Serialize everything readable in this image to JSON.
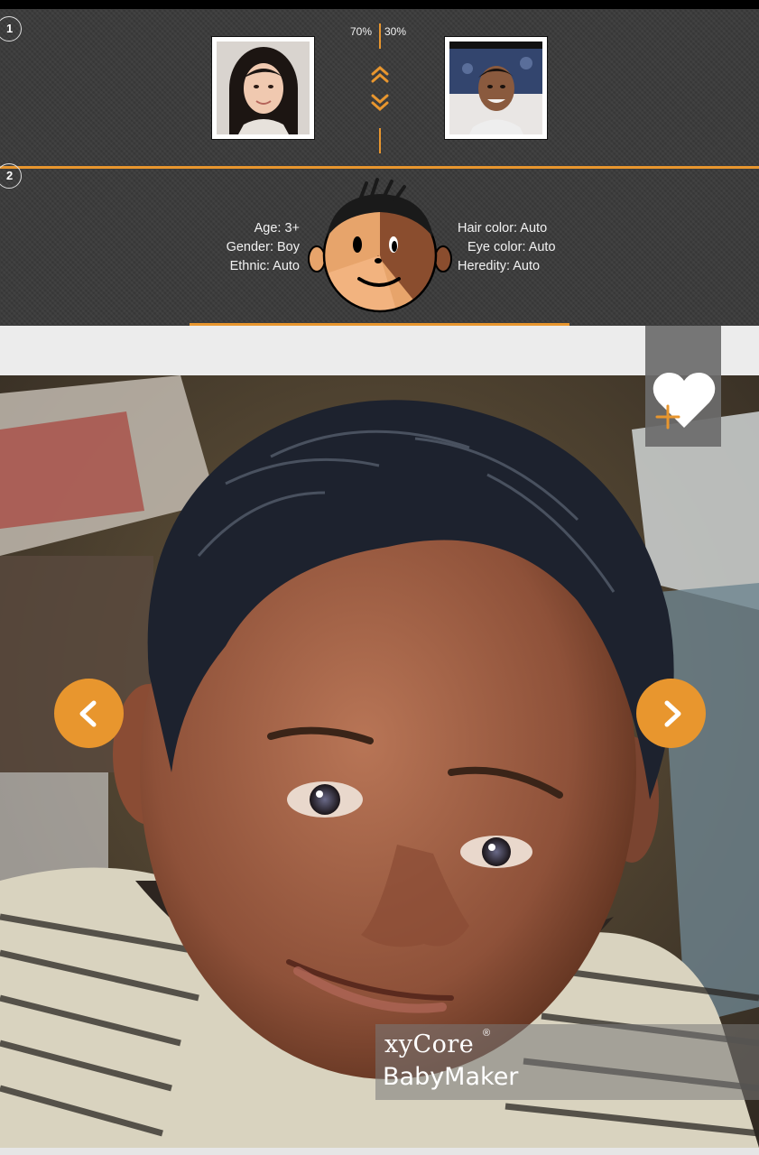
{
  "steps": {
    "step1": "1",
    "step2": "2"
  },
  "parents": {
    "left": {
      "label": "parent-1-photo",
      "percent": "70%"
    },
    "right": {
      "label": "parent-2-photo",
      "percent": "30%"
    }
  },
  "baby_settings": {
    "age": "Age: 3+",
    "gender": "Gender: Boy",
    "ethnic": "Ethnic: Auto",
    "hair_color": "Hair color: Auto",
    "eye_color": "Eye color: Auto",
    "heredity": "Heredity: Auto"
  },
  "result": {
    "watermark_line1": "xyCore",
    "watermark_reg": "®",
    "watermark_line2": "BabyMaker"
  },
  "colors": {
    "accent": "#e8962e",
    "panel": "#3a3a3a",
    "strip": "#ececec"
  },
  "icons": {
    "favorite": "heart-plus-icon",
    "prev": "chevron-left-icon",
    "next": "chevron-right-icon",
    "ratio": "double-chevron-icon"
  }
}
